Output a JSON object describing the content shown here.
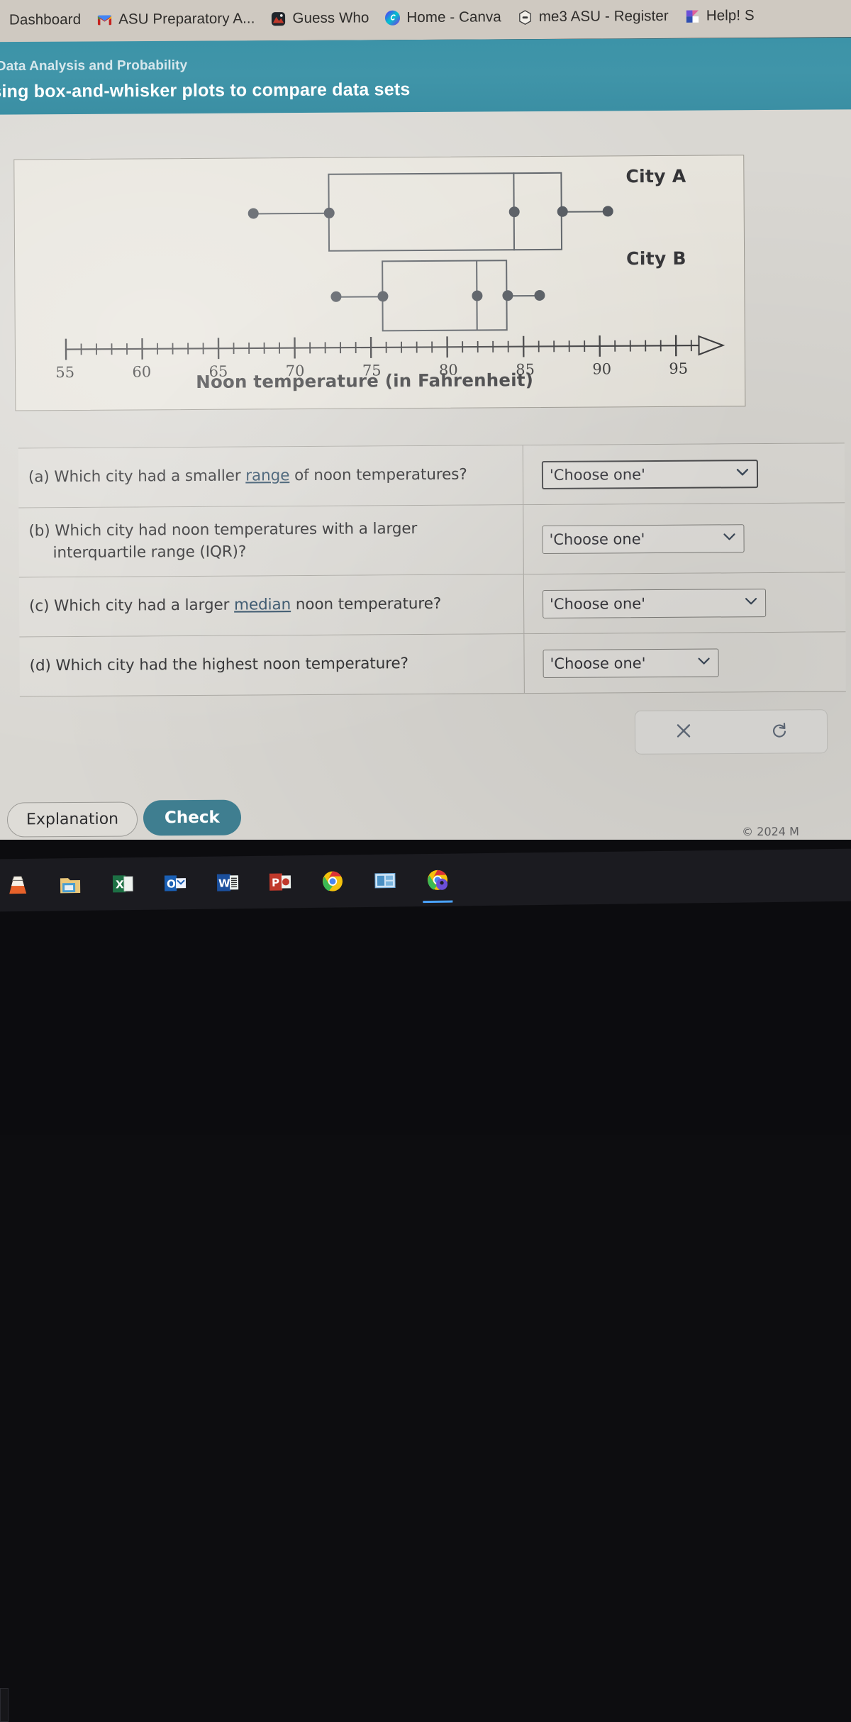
{
  "browser": {
    "bookmarks": [
      {
        "label": "Dashboard",
        "icon": "none"
      },
      {
        "label": "ASU Preparatory A...",
        "icon": "gmail-icon"
      },
      {
        "label": "Guess Who",
        "icon": "guess-who-icon"
      },
      {
        "label": "Home - Canva",
        "icon": "canva-icon"
      },
      {
        "label": "me3 ASU - Register",
        "icon": "me3-icon"
      },
      {
        "label": "Help! S",
        "icon": "help-icon"
      }
    ]
  },
  "header": {
    "topic": "Data Analysis and Probability",
    "title": "Using box-and-whisker plots to compare data sets"
  },
  "chart_data": {
    "type": "box",
    "title": "",
    "xlabel": "Noon temperature (in Fahrenheit)",
    "ylabel": "",
    "xlim": [
      54,
      97
    ],
    "grid": false,
    "tick_labels": [
      "55",
      "60",
      "65",
      "70",
      "75",
      "80",
      "85",
      "90",
      "95"
    ],
    "tick_values": [
      55,
      60,
      65,
      70,
      75,
      80,
      85,
      90,
      95
    ],
    "minor_tick_step": 1,
    "axis_arrow": true,
    "series": [
      {
        "name": "City A",
        "min": 68,
        "q1": 73,
        "median": 85,
        "q3": 88,
        "max": 91,
        "range": 23,
        "iqr": 15
      },
      {
        "name": "City B",
        "min": 73,
        "q1": 76,
        "median": 82,
        "q3": 84,
        "max": 86,
        "range": 13,
        "iqr": 8
      }
    ]
  },
  "questions": [
    {
      "id": "a",
      "prefix": "(a)",
      "text_before": "Which city had a smaller ",
      "term": "range",
      "text_after": " of noon temperatures?",
      "line2": "",
      "dropdown_value": "'Choose one'",
      "caret": "⌄"
    },
    {
      "id": "b",
      "prefix": "(b)",
      "text_before": "Which city had noon temperatures with a larger",
      "term": "",
      "text_after": "",
      "line2": "interquartile range (IQR)?",
      "dropdown_value": "'Choose one'",
      "caret": "⌄"
    },
    {
      "id": "c",
      "prefix": "(c)",
      "text_before": "Which city had a larger ",
      "term": "median",
      "text_after": " noon temperature?",
      "line2": "",
      "dropdown_value": "'Choose one'",
      "caret": "⌄"
    },
    {
      "id": "d",
      "prefix": "(d)",
      "text_before": "Which city had the highest noon temperature?",
      "term": "",
      "text_after": "",
      "line2": "",
      "dropdown_value": "'Choose one'",
      "caret": "⌄"
    }
  ],
  "actions": {
    "clear_icon": "close-x-icon",
    "reset_icon": "refresh-icon"
  },
  "footer": {
    "explanation_label": "Explanation",
    "check_label": "Check",
    "copyright": "© 2024 M"
  },
  "taskbar": {
    "items": [
      {
        "name": "vlc",
        "label": "VLC media player"
      },
      {
        "name": "file-explorer",
        "label": "File Explorer"
      },
      {
        "name": "excel",
        "label": "Excel"
      },
      {
        "name": "outlook",
        "label": "Outlook"
      },
      {
        "name": "word",
        "label": "Word"
      },
      {
        "name": "powerpoint",
        "label": "PowerPoint"
      },
      {
        "name": "chrome",
        "label": "Google Chrome"
      },
      {
        "name": "blue-app",
        "label": "Windows app"
      },
      {
        "name": "chrome-active",
        "label": "Google Chrome"
      }
    ]
  },
  "colors": {
    "header_teal": "#3f93a8",
    "check_button": "#3f7e90",
    "page_bg": "#d9d7d2",
    "figure_bg": "#e7e4dc",
    "plot_stroke": "#555a60",
    "taskbar": "#1b1b20"
  }
}
